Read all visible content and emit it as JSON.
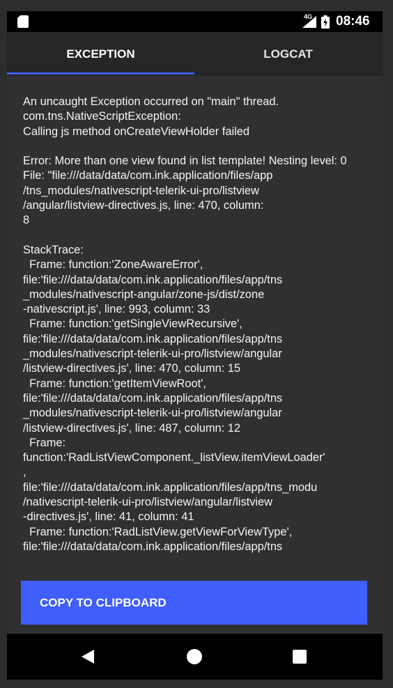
{
  "status_bar": {
    "network_type": "4G",
    "time": "08:46",
    "icons": [
      "sd-card-icon",
      "signal-icon",
      "battery-charging-icon"
    ]
  },
  "tabs": [
    {
      "label": "EXCEPTION",
      "selected": true
    },
    {
      "label": "LOGCAT",
      "selected": false
    }
  ],
  "exception": {
    "text": "An uncaught Exception occurred on \"main\" thread.\ncom.tns.NativeScriptException:\nCalling js method onCreateViewHolder failed\n\nError: More than one view found in list template! Nesting level: 0\nFile: \"file:///data/data/com.ink.application/files/app\n/tns_modules/nativescript-telerik-ui-pro/listview\n/angular/listview-directives.js, line: 470, column:\n8\n\nStackTrace:\n  Frame: function:'ZoneAwareError',\nfile:'file:///data/data/com.ink.application/files/app/tns\n_modules/nativescript-angular/zone-js/dist/zone\n-nativescript.js', line: 993, column: 33\n  Frame: function:'getSingleViewRecursive',\nfile:'file:///data/data/com.ink.application/files/app/tns\n_modules/nativescript-telerik-ui-pro/listview/angular\n/listview-directives.js', line: 470, column: 15\n  Frame: function:'getItemViewRoot',\nfile:'file:///data/data/com.ink.application/files/app/tns\n_modules/nativescript-telerik-ui-pro/listview/angular\n/listview-directives.js', line: 487, column: 12\n  Frame:\nfunction:'RadListViewComponent._listView.itemViewLoader'\n,\nfile:'file:///data/data/com.ink.application/files/app/tns_modu\n/nativescript-telerik-ui-pro/listview/angular/listview\n-directives.js', line: 41, column: 41\n  Frame: function:'RadListView.getViewForViewType',\nfile:'file:///data/data/com.ink.application/files/app/tns"
  },
  "copy_button": {
    "label": "COPY TO CLIPBOARD"
  },
  "nav_bar": {
    "icons": [
      "back-icon",
      "home-icon",
      "recents-icon"
    ]
  },
  "colors": {
    "accent": "#3f5efb",
    "background": "#303030",
    "tab_bar": "#262626",
    "status_bar": "#000000"
  }
}
